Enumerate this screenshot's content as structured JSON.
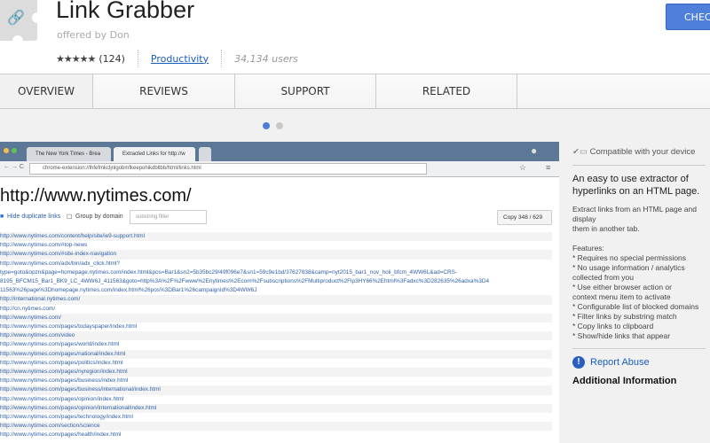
{
  "header": {
    "title": "Link Grabber",
    "offered_by": "offered by Don",
    "rating_stars": "★★★★★",
    "rating_count": "(124)",
    "category": "Productivity",
    "users": "34,134 users",
    "add_button": "CHEC"
  },
  "tabs": [
    {
      "label": "OVERVIEW",
      "active": true
    },
    {
      "label": "REVIEWS"
    },
    {
      "label": "SUPPORT"
    },
    {
      "label": "RELATED"
    }
  ],
  "carousel": {
    "active_index": 0,
    "count": 2
  },
  "screenshot": {
    "browser_tabs": [
      "The New York Times - Brea",
      "Extracted Links for http://w"
    ],
    "url": "chrome-extension://lhfefmkcljnlgobmfkeepohikdbllbb/html/links.html",
    "heading": "http://www.nytimes.com/",
    "hide_duplicates": "Hide duplicate links",
    "group_by_domain": "Group by domain",
    "filter_placeholder": "substring filter",
    "copy_button": "Copy 348 / 629",
    "links": [
      "http://www.nytimes.com/content/help/site/ie9-support.html",
      "http://www.nytimes.com/#top-news",
      "http://www.nytimes.com/#site-index-navigation",
      "http://www.nytimes.com/adx/bin/adx_click.html?\ntype=goto&opzn&page=homepage.nytimes.com/index.html&pos=Bar1&sn2=5b35bc29/49f096e7&sn1=59c9e1bd/37627838&camp=nyt2015_bar1_nov_holi_bfcm_4WW6L&ad=CRS-\n8195_BFCM15_Bar1_BK9_LC_4WW6J_411563&goto=http%3A%2F%2Fwww%2Enytimes%2Ecom%2Fsubscriptions%2FMultiproduct%2Flp3HY66%2Ehtml%3Fadxc%3D282635%26adxa%3D4\n11563%26page%3Dhomepage.nytimes.com/index.html%26pos%3DBar1%26campaignId%3D4WW6J",
      "http://international.nytimes.com/",
      "http://cn.nytimes.com/",
      "http://www.nytimes.com/",
      "http://www.nytimes.com/pages/todayspaper/index.html",
      "http://www.nytimes.com/video",
      "http://www.nytimes.com/pages/world/index.html",
      "http://www.nytimes.com/pages/national/index.html",
      "http://www.nytimes.com/pages/politics/index.html",
      "http://www.nytimes.com/pages/nyregion/index.html",
      "http://www.nytimes.com/pages/business/index.html",
      "http://www.nytimes.com/pages/business/international/index.html",
      "http://www.nytimes.com/pages/opinion/index.html",
      "http://www.nytimes.com/pages/opinion/international/index.html",
      "http://www.nytimes.com/pages/technology/index.html",
      "http://www.nytimes.com/section/science",
      "http://www.nytimes.com/pages/health/index.html"
    ]
  },
  "sidebar": {
    "compatible": "Compatible with your device",
    "summary_line1": "An easy to use extractor of",
    "summary_line2": "hyperlinks on an HTML page.",
    "description": "Extract links from an HTML page and display\nthem in another tab.\n\nFeatures:\n* Requires no special permissions\n* No usage information / analytics\ncollected from you\n* Use either browser action or\ncontext menu item to activate\n* Configurable list of blocked domains\n* Filter links by substring match\n* Copy links to clipboard\n* Show/hide links that appear",
    "report_abuse": "Report Abuse",
    "additional_info": "Additional Information"
  },
  "colors": {
    "accent": "#4d7fdb",
    "link": "#1a5dbf",
    "dot_active": "#4a7fd4",
    "dot_inactive": "#c8c8c8"
  }
}
